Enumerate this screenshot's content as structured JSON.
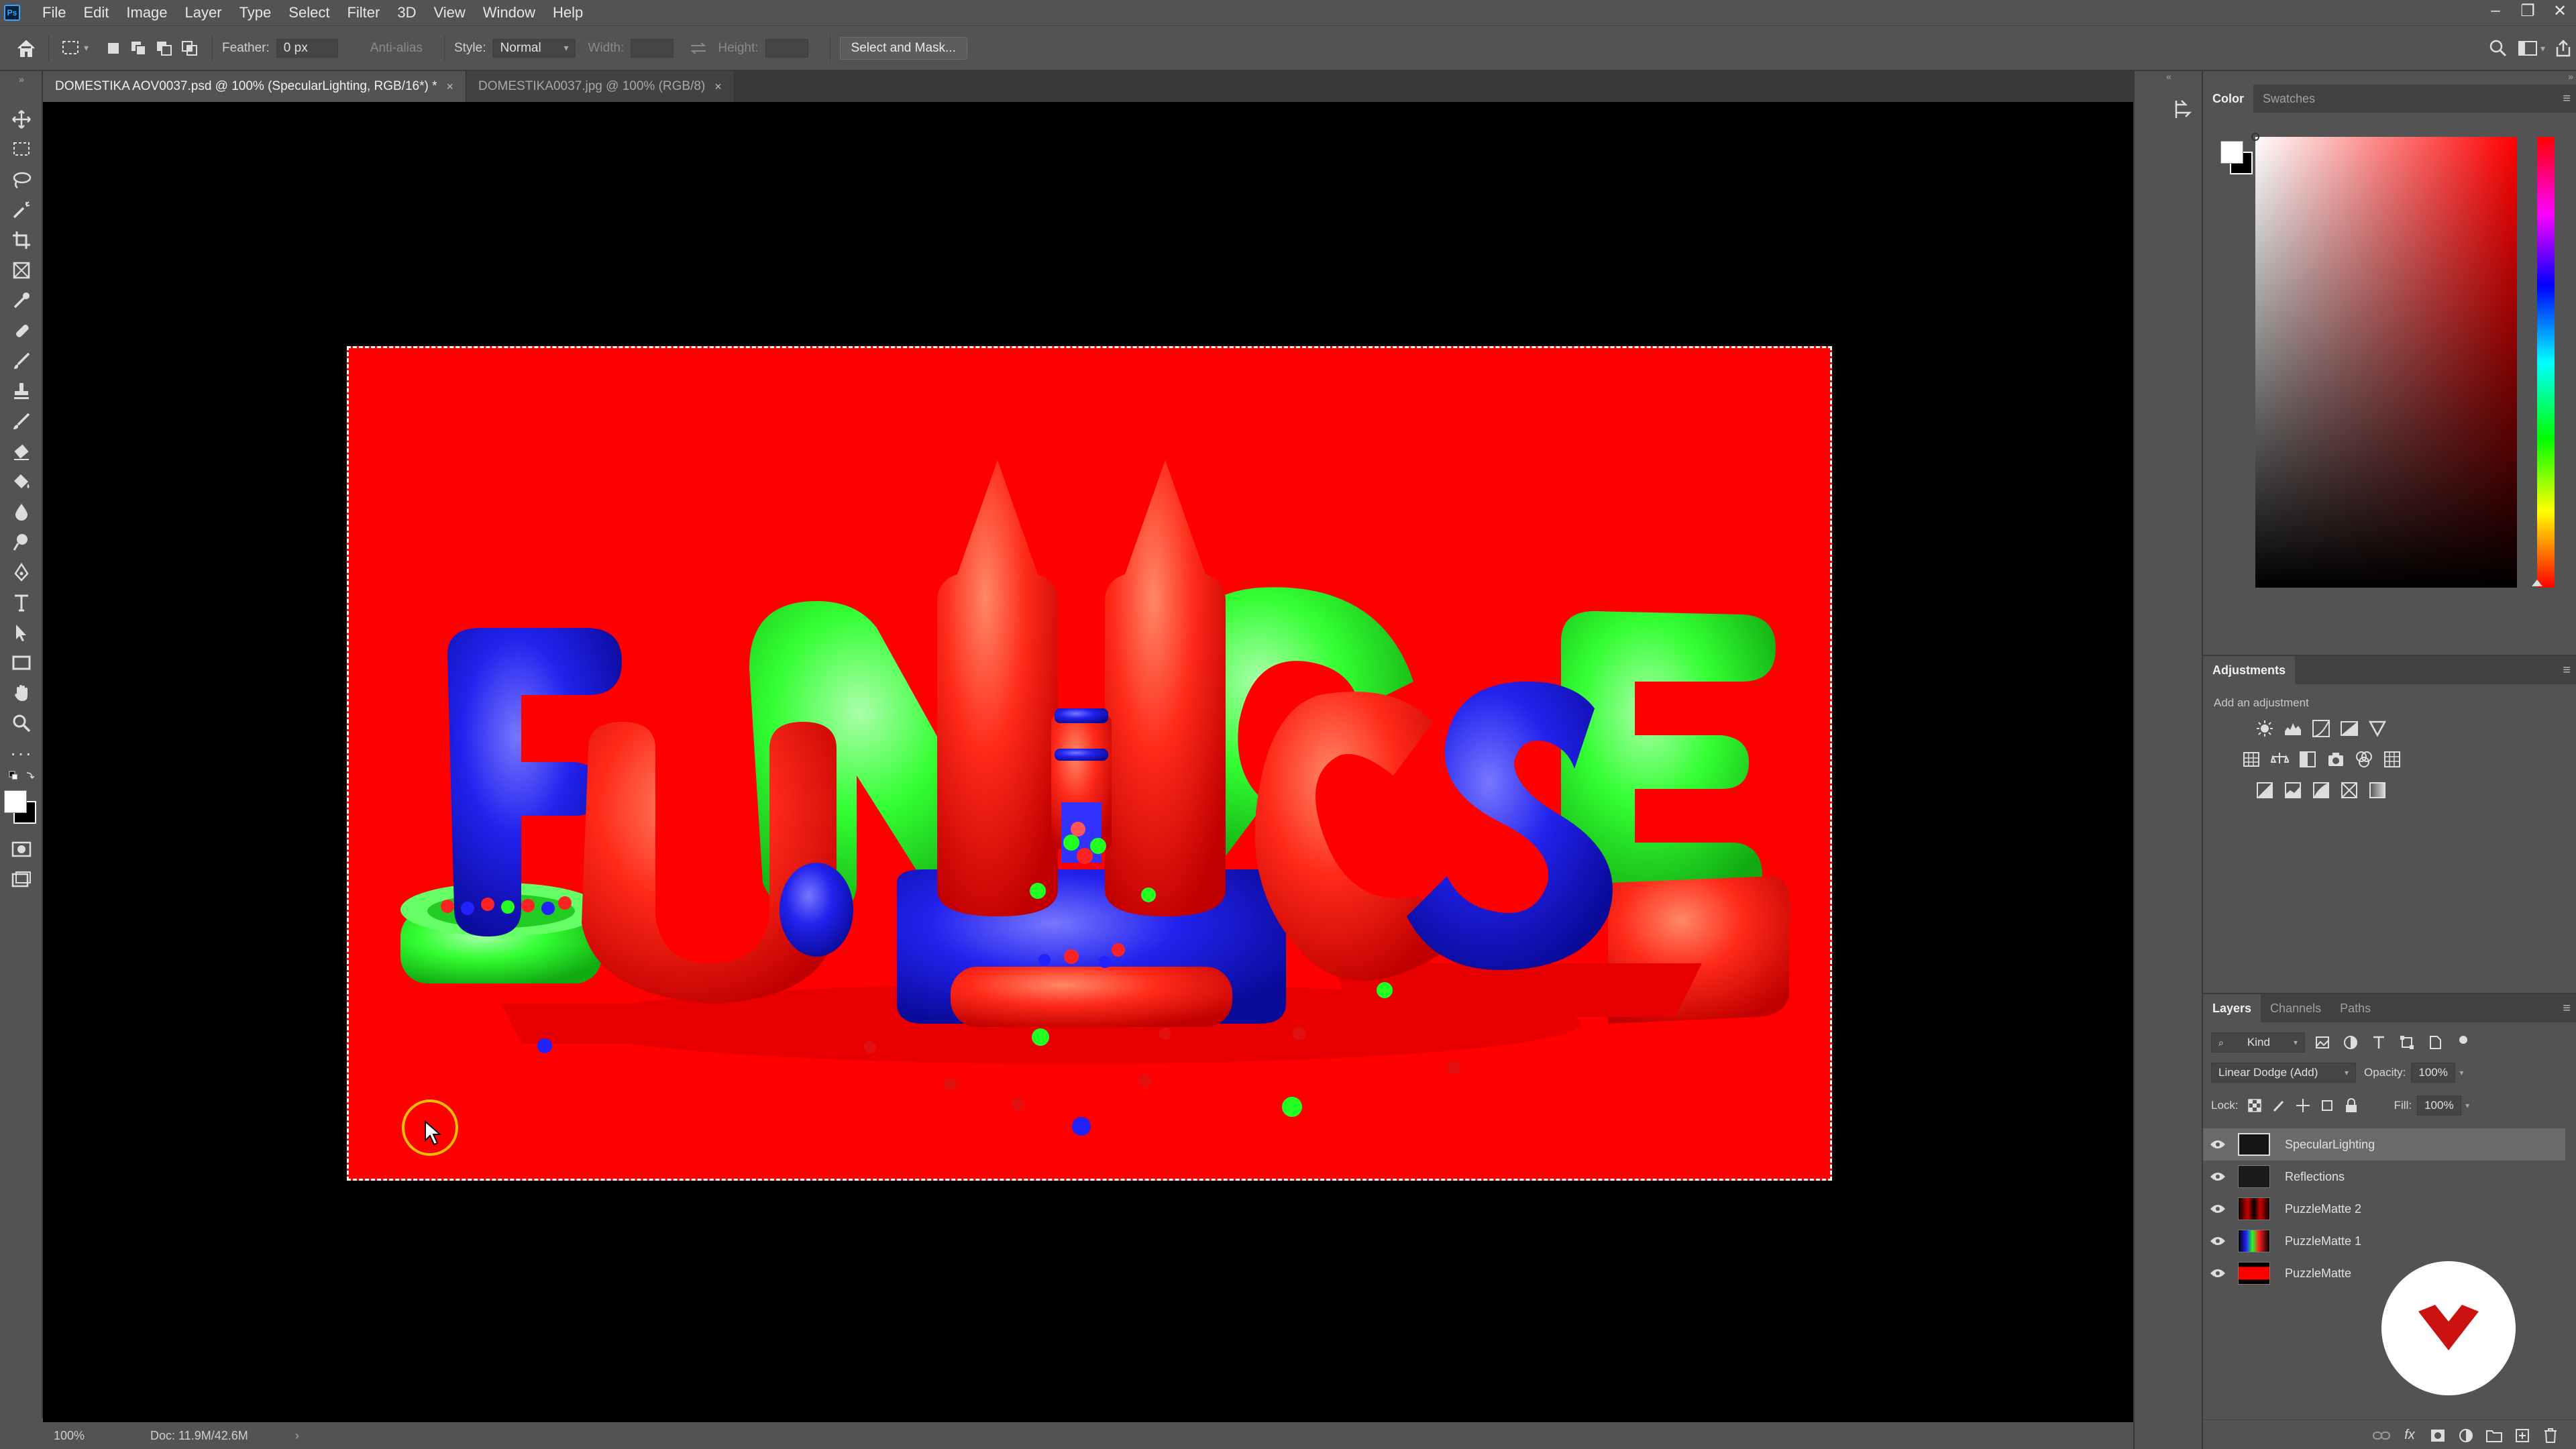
{
  "app": {
    "logo": "Ps"
  },
  "menu": [
    "File",
    "Edit",
    "Image",
    "Layer",
    "Type",
    "Select",
    "Filter",
    "3D",
    "View",
    "Window",
    "Help"
  ],
  "window_controls": {
    "minimize": "–",
    "restore": "❐",
    "close": "✕"
  },
  "options": {
    "feather_label": "Feather:",
    "feather_value": "0 px",
    "anti_alias": "Anti-alias",
    "style_label": "Style:",
    "style_value": "Normal",
    "width_label": "Width:",
    "height_label": "Height:",
    "select_mask": "Select and Mask..."
  },
  "tabs": [
    {
      "label": "DOMESTIKA AOV0037.psd @ 100% (SpecularLighting, RGB/16*) *",
      "close": "×"
    },
    {
      "label": "DOMESTIKA0037.jpg @ 100% (RGB/8)",
      "close": "×"
    }
  ],
  "status": {
    "zoom": "100%",
    "doc": "Doc: 11.9M/42.6M",
    "arrow": "›"
  },
  "color_panel": {
    "tabs": [
      "Color",
      "Swatches"
    ]
  },
  "adjustments": {
    "title": "Adjustments",
    "subtitle": "Add an adjustment"
  },
  "layers_panel": {
    "tabs": [
      "Layers",
      "Channels",
      "Paths"
    ],
    "kind": "Kind",
    "blend_mode": "Linear Dodge (Add)",
    "opacity_label": "Opacity:",
    "opacity_value": "100%",
    "lock_label": "Lock:",
    "fill_label": "Fill:",
    "fill_value": "100%",
    "layers": [
      "SpecularLighting",
      "Reflections",
      "PuzzleMatte 2",
      "PuzzleMatte 1",
      "PuzzleMatte"
    ]
  },
  "colors": {
    "accent_red": "#ff0000",
    "inflatable_green": "#33ff33",
    "inflatable_blue": "#2222ee",
    "ui_bg": "#535353"
  }
}
